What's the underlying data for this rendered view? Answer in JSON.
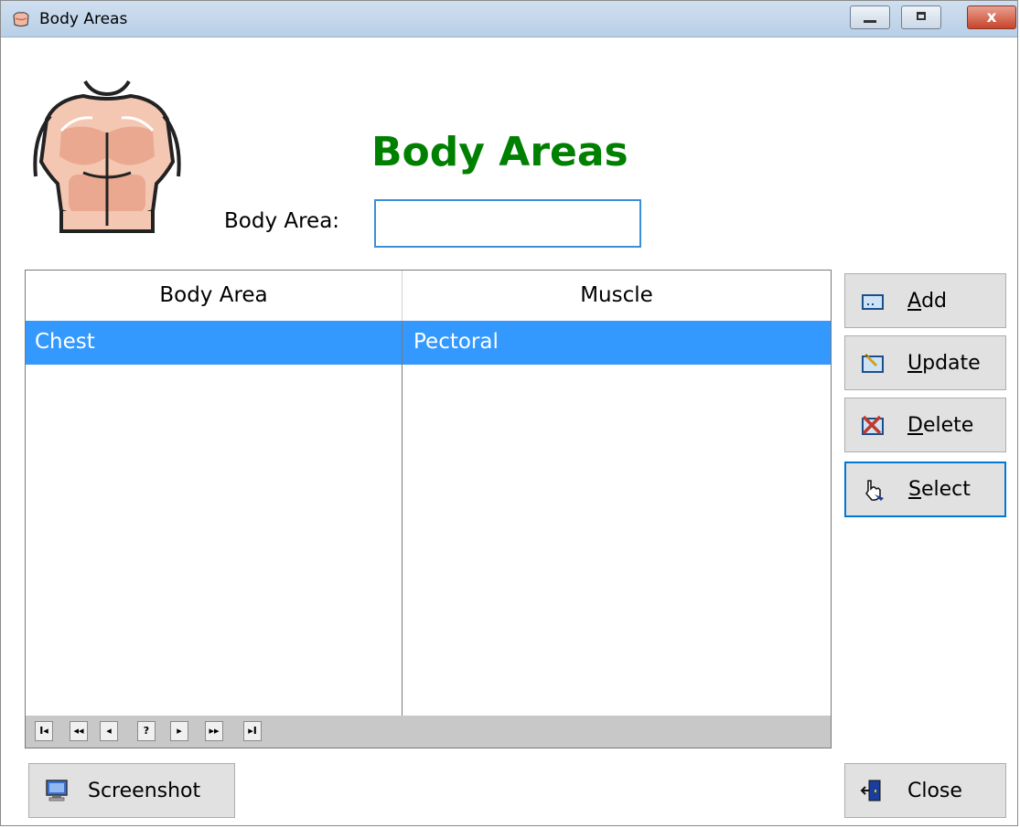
{
  "window": {
    "title": "Body Areas",
    "close_glyph": "x"
  },
  "header": {
    "heading": "Body Areas",
    "logo_icon": "torso-muscles-icon"
  },
  "form": {
    "body_area_label": "Body Area:",
    "body_area_value": ""
  },
  "grid": {
    "columns": [
      "Body Area",
      "Muscle"
    ],
    "rows": [
      {
        "body_area": "Chest",
        "muscle": "Pectoral",
        "selected": true
      }
    ],
    "selection_color": "#3399ff",
    "nav_buttons": [
      "I◂",
      "◂◂",
      "◂",
      "?",
      "▸",
      "▸▸",
      "▸I"
    ]
  },
  "buttons": {
    "add": {
      "first": "A",
      "rest": "dd"
    },
    "update": {
      "first": "U",
      "rest": "pdate"
    },
    "delete": {
      "first": "D",
      "rest": "elete"
    },
    "select": {
      "first": "S",
      "rest": "elect"
    },
    "screenshot": "Screenshot",
    "close": "Close"
  },
  "colors": {
    "heading": "#008000",
    "focus": "#0078d7"
  }
}
